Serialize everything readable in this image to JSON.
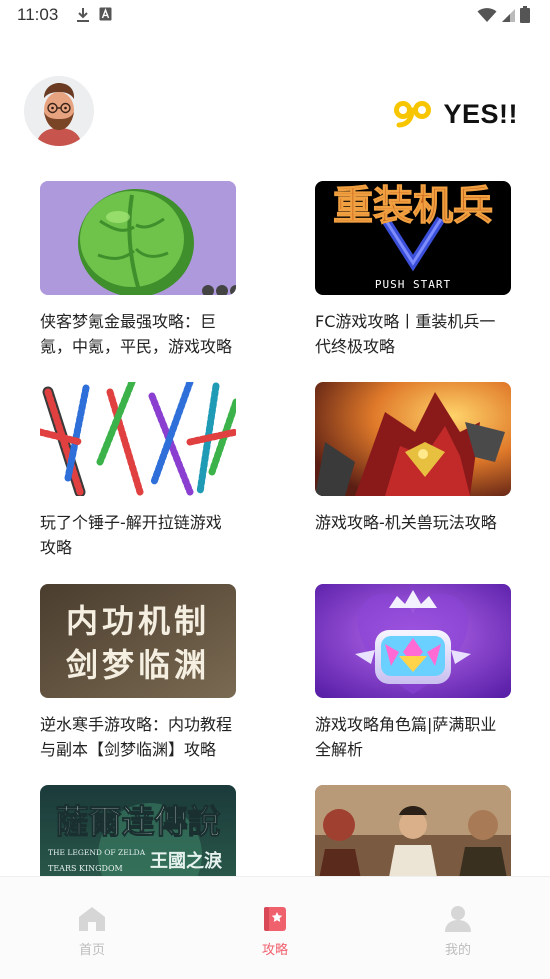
{
  "status_bar": {
    "time": "11:03"
  },
  "header": {
    "brand_logo": "go",
    "brand_text": "YES!!"
  },
  "articles": [
    {
      "title": "侠客梦氪金最强攻略：巨氪，中氪，平民，游戏攻略"
    },
    {
      "title": "FC游戏攻略丨重装机兵一代终极攻略"
    },
    {
      "title": "玩了个锤子-解开拉链游戏攻略"
    },
    {
      "title": "游戏攻略-机关兽玩法攻略"
    },
    {
      "title": "逆水寒手游攻略：内功教程与副本【剑梦临渊】攻略"
    },
    {
      "title": "游戏攻略角色篇|萨满职业全解析"
    },
    {
      "title": ""
    },
    {
      "title": ""
    }
  ],
  "thumbs": {
    "fc_title": "重装机兵",
    "fc_push": "PUSH START",
    "nsh_line1": "内功机制",
    "nsh_line2": "剑梦临渊",
    "zelda_title": "薩爾達傳說",
    "zelda_sub1": "THE LEGEND OF ZELDA",
    "zelda_sub2": "TEARS KINGDOM",
    "zelda_sub3": "王國之淚"
  },
  "nav": [
    {
      "label": "首页",
      "icon": "home-icon"
    },
    {
      "label": "攻略",
      "icon": "guide-bookmark-icon"
    },
    {
      "label": "我的",
      "icon": "user-icon"
    }
  ],
  "colors": {
    "accent": "#f0616e",
    "inactive": "#bdbdbd",
    "brand_yellow": "#f7c600"
  }
}
